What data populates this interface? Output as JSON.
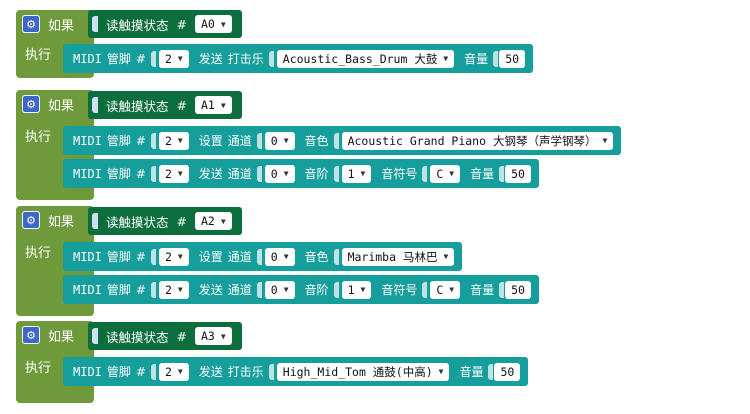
{
  "labels": {
    "if": "如果",
    "do": "执行",
    "read_touch": "读触摸状态",
    "hash": "#",
    "midi": "MIDI",
    "pin": "管脚",
    "send": "发送",
    "set": "设置",
    "drum": "打击乐",
    "channel": "通道",
    "timbre": "音色",
    "scale": "音阶",
    "note": "音符号",
    "volume": "音量"
  },
  "blocks": [
    {
      "touch_pin": "A0",
      "statements": [
        {
          "kind": "drum",
          "pin": "2",
          "instrument": "Acoustic_Bass_Drum 大鼓",
          "volume": "50"
        }
      ]
    },
    {
      "touch_pin": "A1",
      "statements": [
        {
          "kind": "set_timbre",
          "pin": "2",
          "channel": "0",
          "instrument": "Acoustic Grand Piano 大钢琴（声学钢琴）"
        },
        {
          "kind": "send_note",
          "pin": "2",
          "channel": "0",
          "scale": "1",
          "note": "C",
          "volume": "50"
        }
      ]
    },
    {
      "touch_pin": "A2",
      "statements": [
        {
          "kind": "set_timbre",
          "pin": "2",
          "channel": "0",
          "instrument": "Marimba 马林巴"
        },
        {
          "kind": "send_note",
          "pin": "2",
          "channel": "0",
          "scale": "1",
          "note": "C",
          "volume": "50"
        }
      ]
    },
    {
      "touch_pin": "A3",
      "statements": [
        {
          "kind": "drum",
          "pin": "2",
          "instrument": "High_Mid_Tom 通鼓(中高)",
          "volume": "50"
        }
      ]
    }
  ],
  "colors": {
    "logic_block": "#6e9a3c",
    "sensor_block": "#0d6e3d",
    "midi_block": "#159e9c",
    "gear_icon": "#3f68c6"
  },
  "icons": {
    "if_settings": "gear-icon",
    "dropdown": "dropdown-arrow-icon"
  }
}
